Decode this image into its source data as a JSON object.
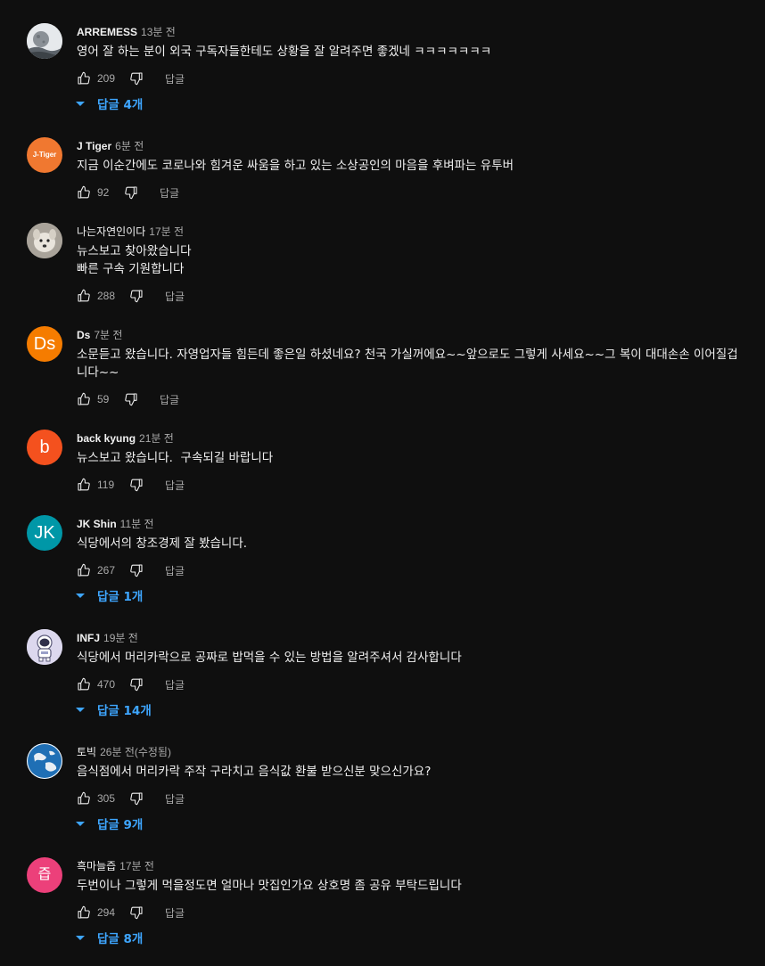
{
  "ui": {
    "reply_label": "답글"
  },
  "comments": [
    {
      "author": "ARREMESS",
      "time": "13분 전",
      "text": "영어 잘 하는 분이 외국 구독자들한테도 상황을 잘 알려주면 좋겠네 ㅋㅋㅋㅋㅋㅋㅋ",
      "likes": "209",
      "replies_label": "답글 4개",
      "avatar": {
        "type": "image",
        "icon": "moon-landscape-photo",
        "bg": "#dfe3e6"
      }
    },
    {
      "author": "J Tiger",
      "time": "6분 전",
      "text": "지금 이순간에도 코로나와 힘겨운 싸움을 하고 있는 소상공인의 마음을 후벼파는 유투버",
      "likes": "92",
      "avatar": {
        "type": "letters",
        "letters": "J-Tiger",
        "bg": "#f07830"
      }
    },
    {
      "author": "나는자연인이다",
      "time": "17분 전",
      "text": "뉴스보고 찾아왔습니다\n빠른 구속 기원합니다",
      "likes": "288",
      "avatar": {
        "type": "image",
        "icon": "dog-photo",
        "bg": "#b9b3aa"
      }
    },
    {
      "author": "Ds",
      "time": "7분 전",
      "text": "소문듣고 왔습니다. 자영업자들 힘든데 좋은일 하셨네요? 천국 가실꺼에요~~앞으로도 그렇게 사세요~~그 복이 대대손손 이어질겁니다~~",
      "likes": "59",
      "avatar": {
        "type": "letters",
        "letters": "Ds",
        "bg": "#f57c00"
      }
    },
    {
      "author": "back kyung",
      "time": "21분 전",
      "text": "뉴스보고 왔습니다.  구속되길 바랍니다",
      "likes": "119",
      "avatar": {
        "type": "letters",
        "letters": "b",
        "bg": "#f4511e"
      }
    },
    {
      "author": "JK Shin",
      "time": "11분 전",
      "text": "식당에서의 창조경제 잘 봤습니다.",
      "likes": "267",
      "replies_label": "답글 1개",
      "avatar": {
        "type": "letters",
        "letters": "JK",
        "bg": "#0097a7"
      }
    },
    {
      "author": "INFJ",
      "time": "19분 전",
      "text": "식당에서 머리카락으로 공짜로 밥먹을 수 있는 방법을 알려주셔서 감사합니다",
      "likes": "470",
      "replies_label": "답글 14개",
      "avatar": {
        "type": "image",
        "icon": "astronaut-illustration",
        "bg": "#e3e0f0"
      }
    },
    {
      "author": "토빅",
      "time": "26분 전(수정됨)",
      "text": "음식점에서 머리카락 주작 구라치고 음식값 환불 받으신분 맞으신가요?",
      "likes": "305",
      "replies_label": "답글 9개",
      "avatar": {
        "type": "image",
        "icon": "globe-photo",
        "bg": "#1f6fb5"
      }
    },
    {
      "author": "흑마늘즙",
      "time": "17분 전",
      "text": "두번이나 그렇게 먹을정도면 얼마나 맛집인가요 상호명 좀 공유 부탁드립니다",
      "likes": "294",
      "replies_label": "답글 8개",
      "avatar": {
        "type": "letters",
        "letters": "즙",
        "bg": "#ec407a"
      }
    }
  ]
}
